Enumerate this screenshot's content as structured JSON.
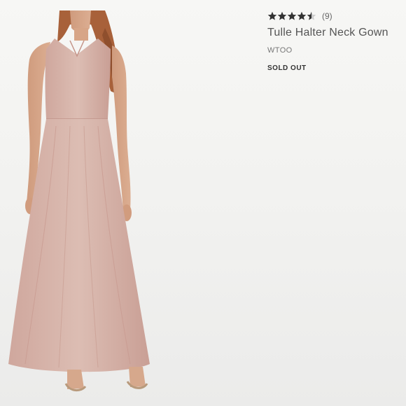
{
  "product": {
    "rating": 4.5,
    "rating_max": 5,
    "review_count": "(9)",
    "title": "Tulle Halter Neck Gown",
    "brand": "WTOO",
    "status": "SOLD OUT",
    "image": {
      "icon": "product-photo",
      "dress_color": "#d9b7ad",
      "skin_color": "#d9a88a",
      "hair_color": "#a8613a"
    }
  },
  "colors": {
    "star_filled": "#333333",
    "star_empty": "#cccccc"
  }
}
